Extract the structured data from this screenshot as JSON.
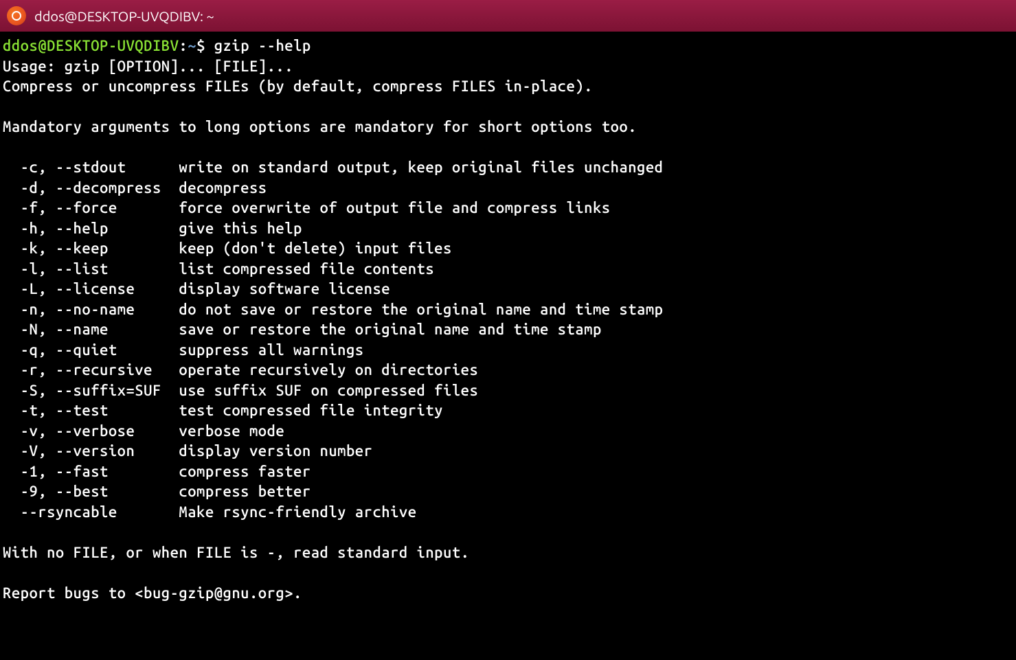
{
  "titlebar": {
    "title": "ddos@DESKTOP-UVQDIBV: ~"
  },
  "prompt": {
    "user": "ddos",
    "at": "@",
    "host": "DESKTOP-UVQDIBV",
    "colon": ":",
    "path": "~",
    "dollar": "$"
  },
  "command": "gzip --help",
  "output": {
    "usage": "Usage: gzip [OPTION]... [FILE]...",
    "desc": "Compress or uncompress FILEs (by default, compress FILES in-place).",
    "blank1": "",
    "mandatory": "Mandatory arguments to long options are mandatory for short options too.",
    "blank2": "",
    "options": [
      "  -c, --stdout      write on standard output, keep original files unchanged",
      "  -d, --decompress  decompress",
      "  -f, --force       force overwrite of output file and compress links",
      "  -h, --help        give this help",
      "  -k, --keep        keep (don't delete) input files",
      "  -l, --list        list compressed file contents",
      "  -L, --license     display software license",
      "  -n, --no-name     do not save or restore the original name and time stamp",
      "  -N, --name        save or restore the original name and time stamp",
      "  -q, --quiet       suppress all warnings",
      "  -r, --recursive   operate recursively on directories",
      "  -S, --suffix=SUF  use suffix SUF on compressed files",
      "  -t, --test        test compressed file integrity",
      "  -v, --verbose     verbose mode",
      "  -V, --version     display version number",
      "  -1, --fast        compress faster",
      "  -9, --best        compress better",
      "  --rsyncable       Make rsync-friendly archive"
    ],
    "blank3": "",
    "nofile": "With no FILE, or when FILE is -, read standard input.",
    "blank4": "",
    "report": "Report bugs to <bug-gzip@gnu.org>."
  }
}
